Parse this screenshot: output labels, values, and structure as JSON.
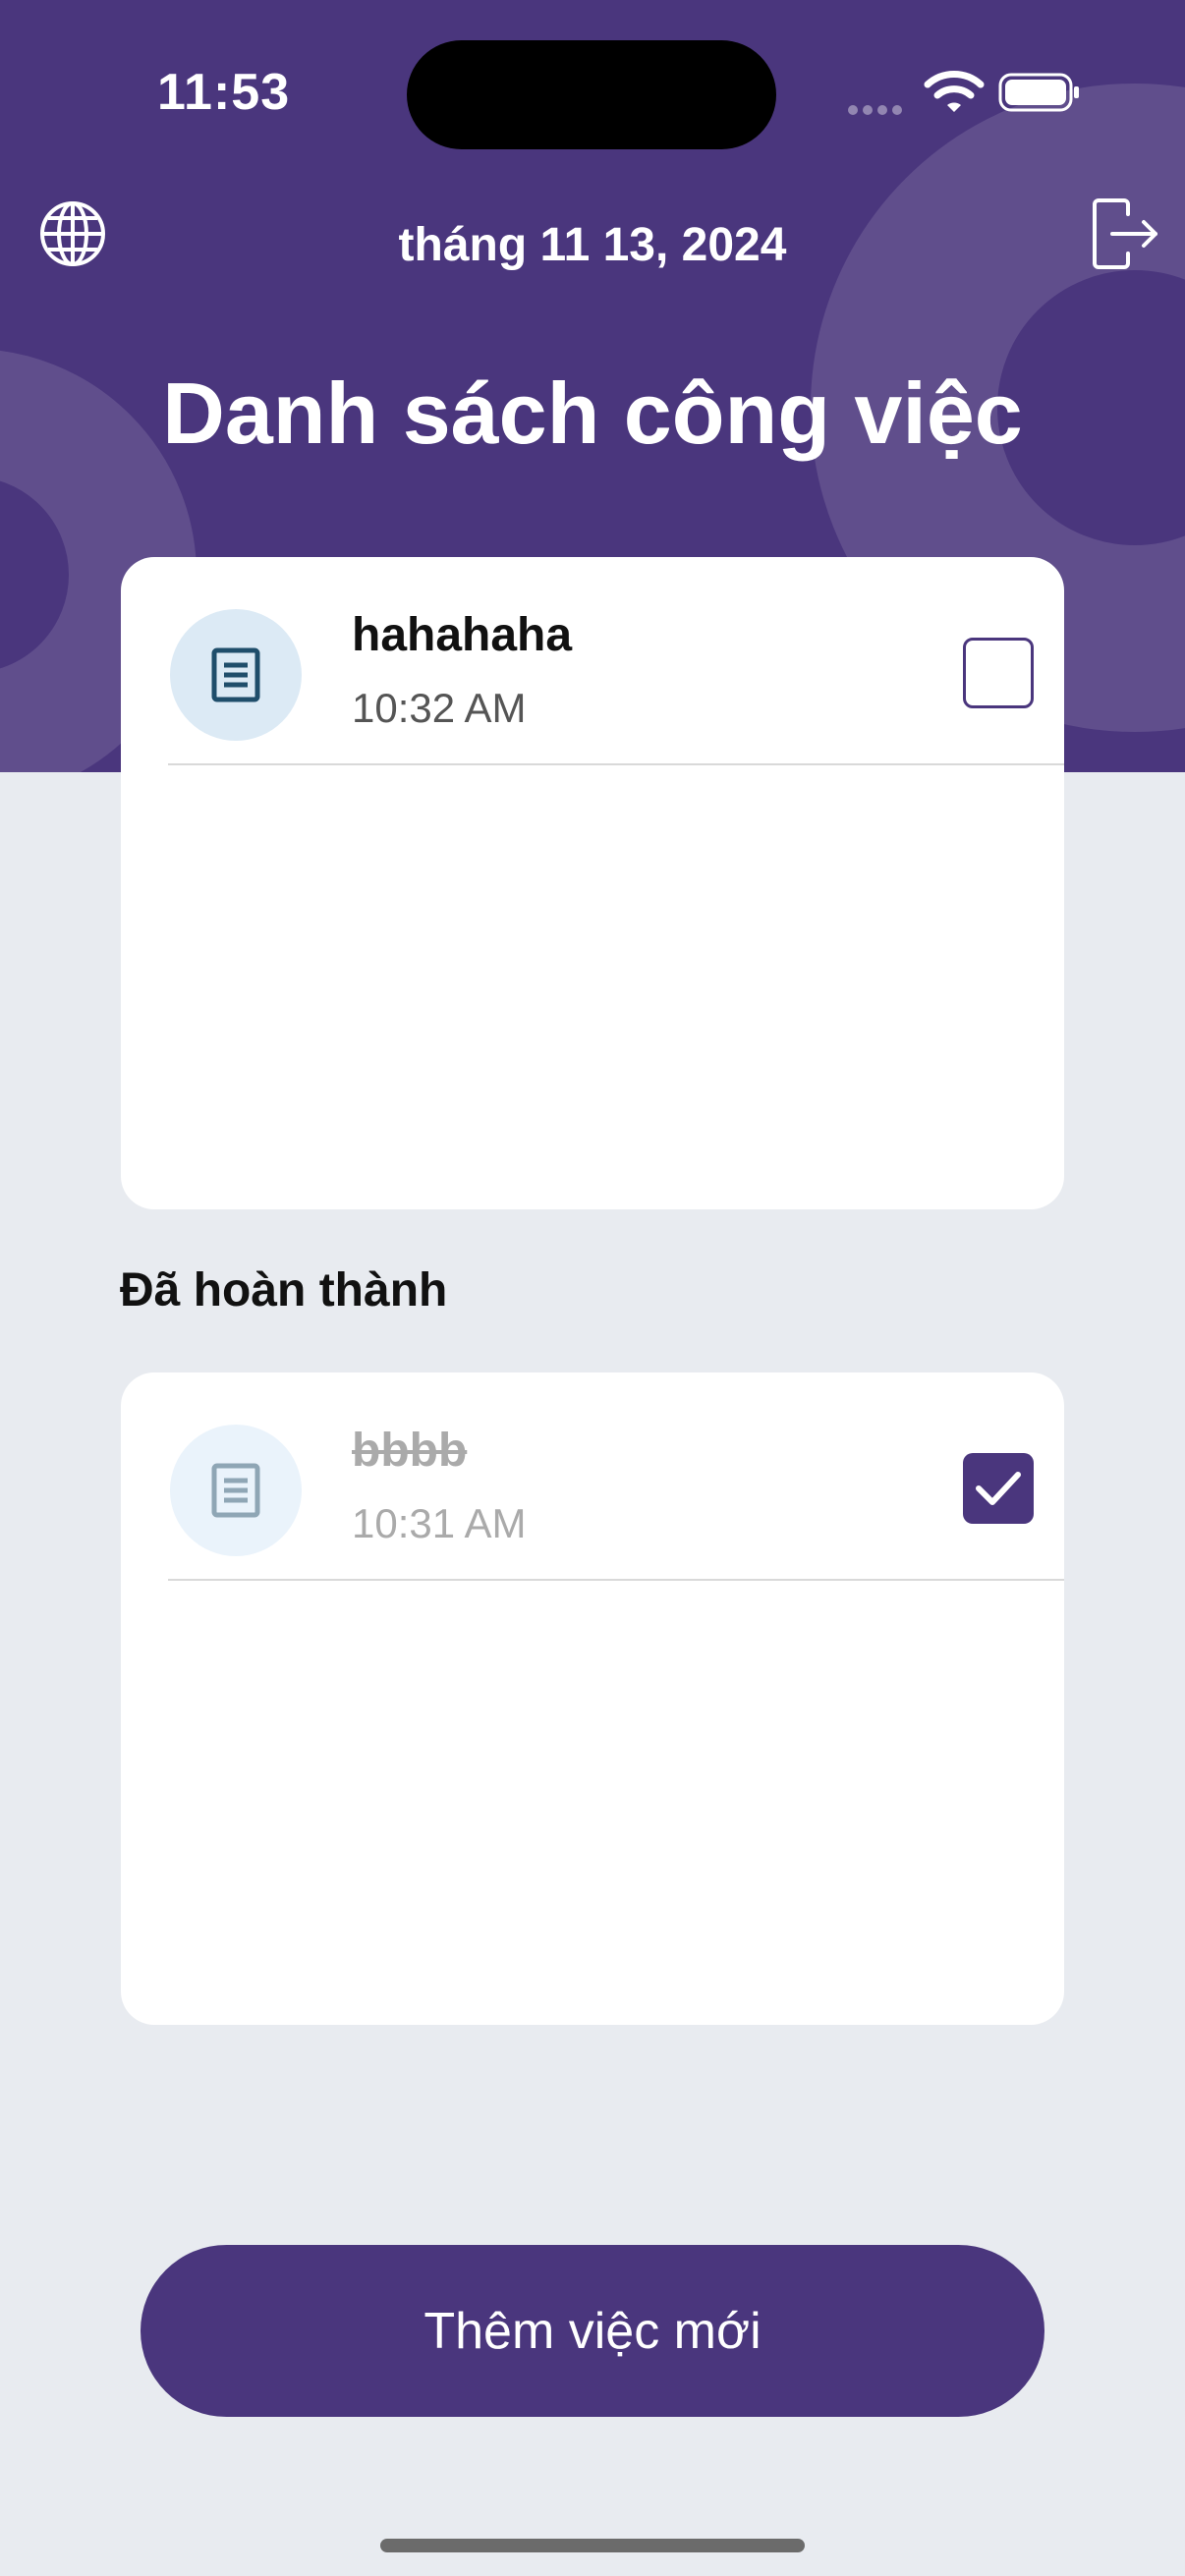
{
  "status_bar": {
    "time": "11:53",
    "icons": [
      "cellular-signal-icon",
      "wifi-icon",
      "battery-icon"
    ]
  },
  "header": {
    "date": "tháng 11 13, 2024",
    "title": "Danh sách công việc",
    "left_icon": "globe-icon",
    "right_icon": "logout-icon",
    "background_color": "#4a367d"
  },
  "todo_tasks": [
    {
      "title": "hahahaha",
      "time": "10:32 AM",
      "completed": false,
      "icon": "document-icon"
    }
  ],
  "completed_section": {
    "heading": "Đã hoàn thành",
    "tasks": [
      {
        "title": "bbbb",
        "time": "10:31 AM",
        "completed": true,
        "icon": "document-icon"
      }
    ]
  },
  "add_button": {
    "label": "Thêm việc mới"
  },
  "colors": {
    "accent": "#4a367d",
    "page_background": "#e8ebf0",
    "card_background": "#ffffff"
  }
}
